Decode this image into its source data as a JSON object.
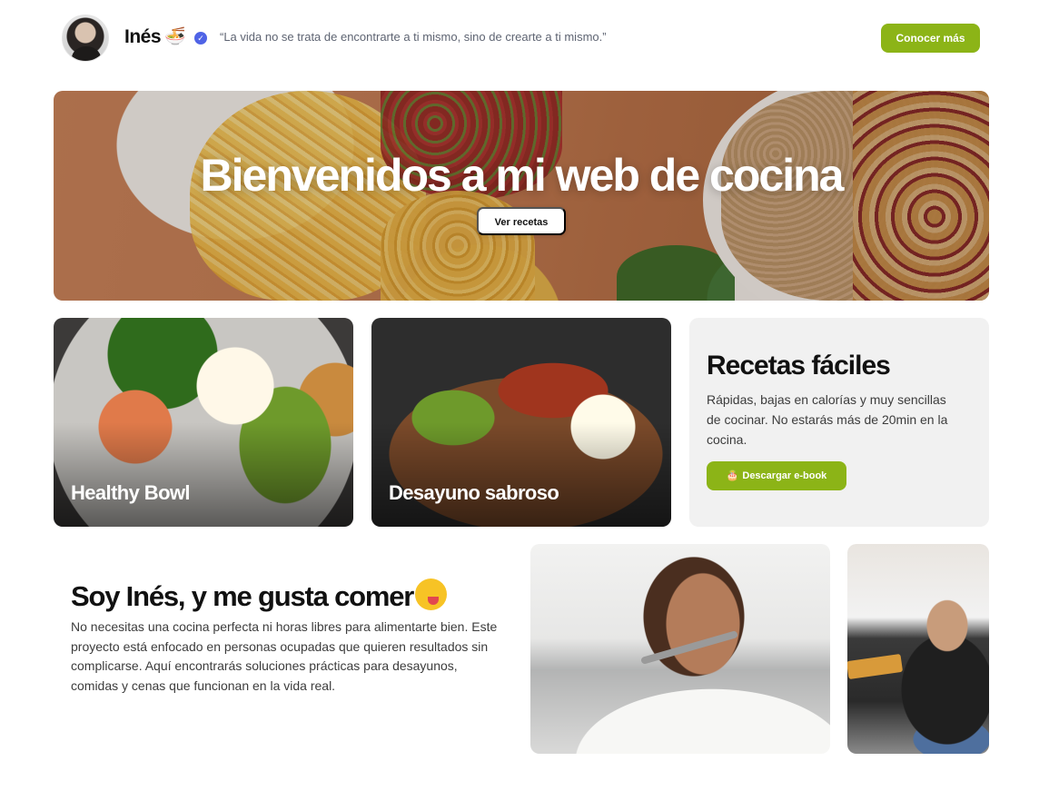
{
  "header": {
    "name": "Inés",
    "name_emoji": "🍜",
    "verified_icon": "verified-badge-icon",
    "quote": "“La vida no se trata de encontrarte a ti mismo, sino de crearte a ti mismo.”",
    "cta_label": "Conocer más"
  },
  "hero": {
    "title": "Bienvenidos a mi web de cocina",
    "button_label": "Ver recetas"
  },
  "cards": [
    {
      "label": "Healthy Bowl"
    },
    {
      "label": "Desayuno sabroso"
    }
  ],
  "info_card": {
    "title": "Recetas fáciles",
    "text": "Rápidas, bajas en calorías y muy sencillas de cocinar. No estarás más de 20min en la cocina.",
    "button_icon": "🎂",
    "button_label": "Descargar e-book"
  },
  "about": {
    "title": "Soy Inés, y me gusta comer",
    "text": "No necesitas una cocina perfecta ni horas libres para alimentarte bien. Este proyecto está enfocado en personas ocupadas que quieren resultados sin complicarse. Aquí encontrarás soluciones prácticas para desayunos, comidas y cenas que funcionan en la vida real."
  },
  "colors": {
    "accent": "#8cb417",
    "verified": "#4f63e6",
    "card_bg": "#f1f1f1"
  }
}
